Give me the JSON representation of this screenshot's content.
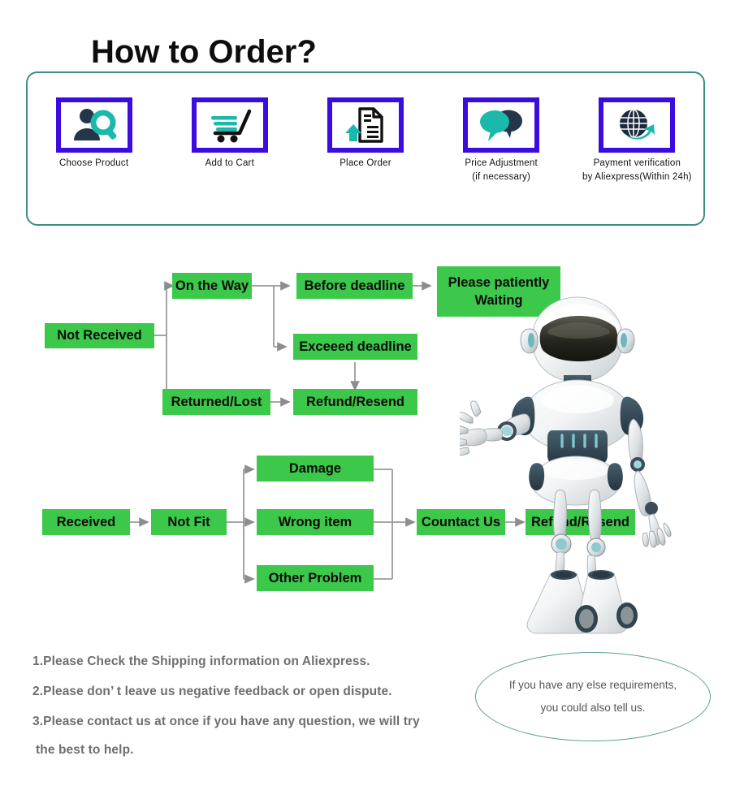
{
  "order_panel": {
    "title": "How to Order?",
    "steps": [
      {
        "icon": "person-search-icon",
        "label": "Choose  Product",
        "label2": ""
      },
      {
        "icon": "shopping-cart-icon",
        "label": "Add to Cart",
        "label2": ""
      },
      {
        "icon": "document-upload-icon",
        "label": "Place  Order",
        "label2": ""
      },
      {
        "icon": "chat-bubbles-icon",
        "label": "Price Adjustment",
        "label2": "(if necessary)"
      },
      {
        "icon": "globe-arrow-icon",
        "label": "Payment verification",
        "label2": "by Aliexpress(Within 24h)"
      }
    ]
  },
  "flowchart": {
    "boxes": [
      {
        "id": "not-received",
        "label": "Not Received"
      },
      {
        "id": "on-the-way",
        "label": "On the Way"
      },
      {
        "id": "before-deadline",
        "label": "Before deadline"
      },
      {
        "id": "please-waiting",
        "label": "Please patiently Waiting"
      },
      {
        "id": "exceed-deadline",
        "label": "Exceeed deadline"
      },
      {
        "id": "returned-lost",
        "label": "Returned/Lost"
      },
      {
        "id": "refund-resend-1",
        "label": "Refund/Resend"
      },
      {
        "id": "received",
        "label": "Received"
      },
      {
        "id": "not-fit",
        "label": "Not Fit"
      },
      {
        "id": "damage",
        "label": "Damage"
      },
      {
        "id": "wrong-item",
        "label": "Wrong item"
      },
      {
        "id": "other-problem",
        "label": "Other Problem"
      },
      {
        "id": "contact-us",
        "label": "Countact Us"
      },
      {
        "id": "refund-resend-2",
        "label": "Refund/Resend"
      }
    ]
  },
  "notes": {
    "items": [
      "1.Please Check the Shipping information on Aliexpress.",
      "2.Please don’ t leave us negative feedback or open dispute.",
      "3.Please contact us at once if you have any question, we will try",
      " the best to help."
    ]
  },
  "bubble": {
    "line1": "If you have any else requirements,",
    "line2": "you could also tell us."
  },
  "colors": {
    "panel_border": "#3f8c82",
    "icon_border": "#3a0ce0",
    "icon_accent": "#1ab9ac",
    "icon_dark": "#24364a",
    "box_green": "#3cc84a",
    "arrow_gray": "#9a9a9a",
    "note_text": "#6e6e6e",
    "bubble_border": "#5f9d95"
  }
}
